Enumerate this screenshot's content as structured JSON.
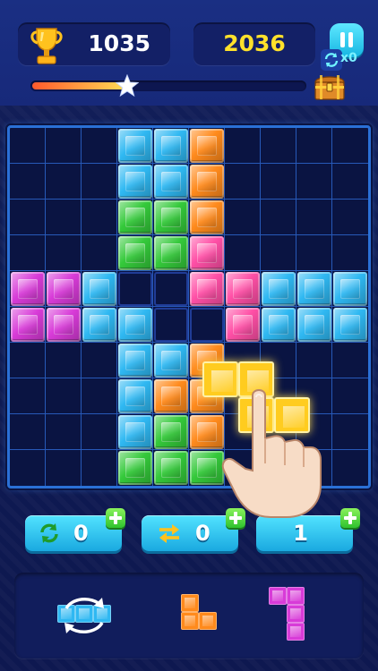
{
  "scores": {
    "current": "1035",
    "best": "2036"
  },
  "refill": {
    "count_label": "x0"
  },
  "progress": {
    "fraction": 0.35
  },
  "board": {
    "rows": 10,
    "cols": 10,
    "palette": {
      "C": "#2fb8f2",
      "O": "#ff8a1c",
      "G": "#34c93a",
      "P": "#ff4fa6",
      "M": "#d83bd8",
      "Y": "#ffcc1f",
      "E": "frame",
      ".": "empty"
    },
    "grid": [
      "...CCO....",
      "...CCO....",
      "...GGO....",
      "...GGP....",
      "MMCEEPPCCC",
      "MMCCEEPCCC",
      "...CCO....",
      "...COO....",
      "...CGO....",
      "...GGG...."
    ]
  },
  "drag_piece": {
    "color": "#ffcc1f",
    "cells": [
      [
        0,
        0
      ],
      [
        0,
        1
      ],
      [
        1,
        1
      ],
      [
        1,
        2
      ]
    ]
  },
  "boosters": [
    {
      "name": "refresh",
      "count": "0",
      "has_plus": true,
      "icon": "refresh-icon"
    },
    {
      "name": "swap",
      "count": "0",
      "has_plus": true,
      "icon": "swap-arrows-icon"
    },
    {
      "name": "extra",
      "count": "1",
      "has_plus": true,
      "icon": ""
    }
  ],
  "tray": [
    {
      "icon": "rotate-piece-icon",
      "color": "#2fb8f2",
      "cells": [
        [
          0,
          0
        ],
        [
          0,
          1
        ],
        [
          0,
          2
        ]
      ]
    },
    {
      "color": "#ff8a1c",
      "cells": [
        [
          0,
          0
        ],
        [
          1,
          0
        ],
        [
          1,
          1
        ]
      ]
    },
    {
      "color": "#d83bd8",
      "cells": [
        [
          0,
          0
        ],
        [
          0,
          1
        ],
        [
          1,
          1
        ],
        [
          2,
          1
        ]
      ]
    }
  ]
}
